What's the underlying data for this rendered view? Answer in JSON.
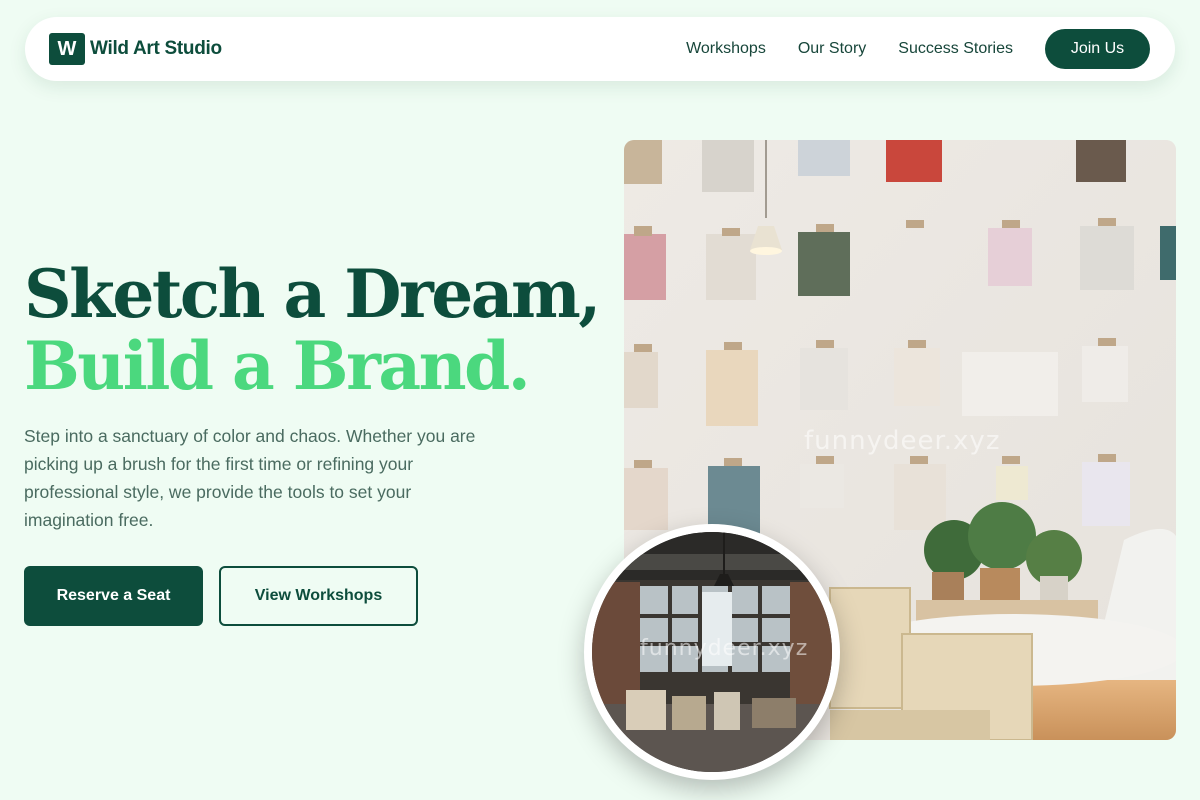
{
  "brand": {
    "logo_letter": "W",
    "name": "Wild Art Studio"
  },
  "nav": {
    "links": [
      "Workshops",
      "Our Story",
      "Success Stories"
    ],
    "cta": "Join Us"
  },
  "hero": {
    "headline_line1": "Sketch a Dream,",
    "headline_line2": "Build a Brand.",
    "lede": "Step into a sanctuary of color and chaos. Whether you are picking up a brush for the first time or refining your professional style, we provide the tools to set your imagination free.",
    "primary_cta": "Reserve a Seat",
    "secondary_cta": "View Workshops"
  },
  "images": {
    "main_watermark": "funnydeer.xyz",
    "circle_watermark": "funnydeer.xyz"
  },
  "colors": {
    "page_bg": "#effcf3",
    "brand_dark": "#0d4d3c",
    "brand_accent": "#4bd87e",
    "body_text": "#4a6b60"
  }
}
